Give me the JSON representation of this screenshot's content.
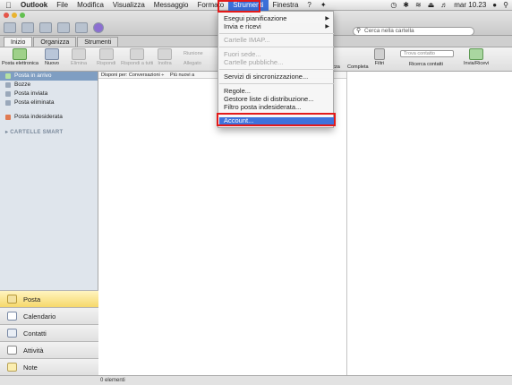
{
  "menubar": {
    "app_name": "Outlook",
    "items": [
      "File",
      "Modifica",
      "Visualizza",
      "Messaggio",
      "Formato",
      "Strumenti",
      "Finestra",
      "?"
    ],
    "clock": "mar 10.23"
  },
  "search": {
    "placeholder": "Cerca nella cartella"
  },
  "tabs": [
    "Inizio",
    "Organizza",
    "Strumenti"
  ],
  "ribbon": {
    "posta_elettronica": "Posta elettronica",
    "nuovo": "Nuovo",
    "elimina": "Elimina",
    "rispondi": "Rispondi",
    "rispondi_a_tutti": "Rispondi a tutti",
    "inoltra": "Inoltra",
    "riunione": "Riunione",
    "allegato": "Allegato",
    "contrassegna": "izza",
    "completa": "Completa",
    "filtri": "Filtri",
    "trova_contatto": "Trova contatto",
    "ricerca_contatti": "Ricerca contatti",
    "invia_ricevi": "Invia/Ricevi"
  },
  "sidebar": {
    "items": [
      {
        "label": "Posta in arrivo",
        "selected": true
      },
      {
        "label": "Bozze"
      },
      {
        "label": "Posta inviata"
      },
      {
        "label": "Posta eliminata"
      },
      {
        "label": "Posta indesiderata"
      }
    ],
    "smart_folders": "CARTELLE SMART",
    "nav": [
      "Posta",
      "Calendario",
      "Contatti",
      "Attività",
      "Note"
    ]
  },
  "list": {
    "arrange": "Disponi per: Conversazioni ÷",
    "sort": "Più nuovi a"
  },
  "status": {
    "count": "0 elementi"
  },
  "dropdown": {
    "items": [
      {
        "label": "Esegui pianificazione",
        "submenu": true,
        "enabled": true
      },
      {
        "label": "Invia e ricevi",
        "submenu": true,
        "enabled": true
      },
      {
        "label": "Cartelle IMAP...",
        "enabled": false
      },
      {
        "label": "Fuori sede...",
        "enabled": false
      },
      {
        "label": "Cartelle pubbliche...",
        "enabled": false
      },
      {
        "label": "Servizi di sincronizzazione...",
        "enabled": true
      },
      {
        "label": "Regole...",
        "enabled": true
      },
      {
        "label": "Gestore liste di distribuzione...",
        "enabled": true
      },
      {
        "label": "Filtro posta indesiderata...",
        "enabled": true
      },
      {
        "label": "Account...",
        "enabled": true,
        "highlighted": true
      }
    ]
  },
  "colors": {
    "highlight": "#3e72dc",
    "annotation": "#e31a1a",
    "selected_nav": "#f6d86b"
  }
}
